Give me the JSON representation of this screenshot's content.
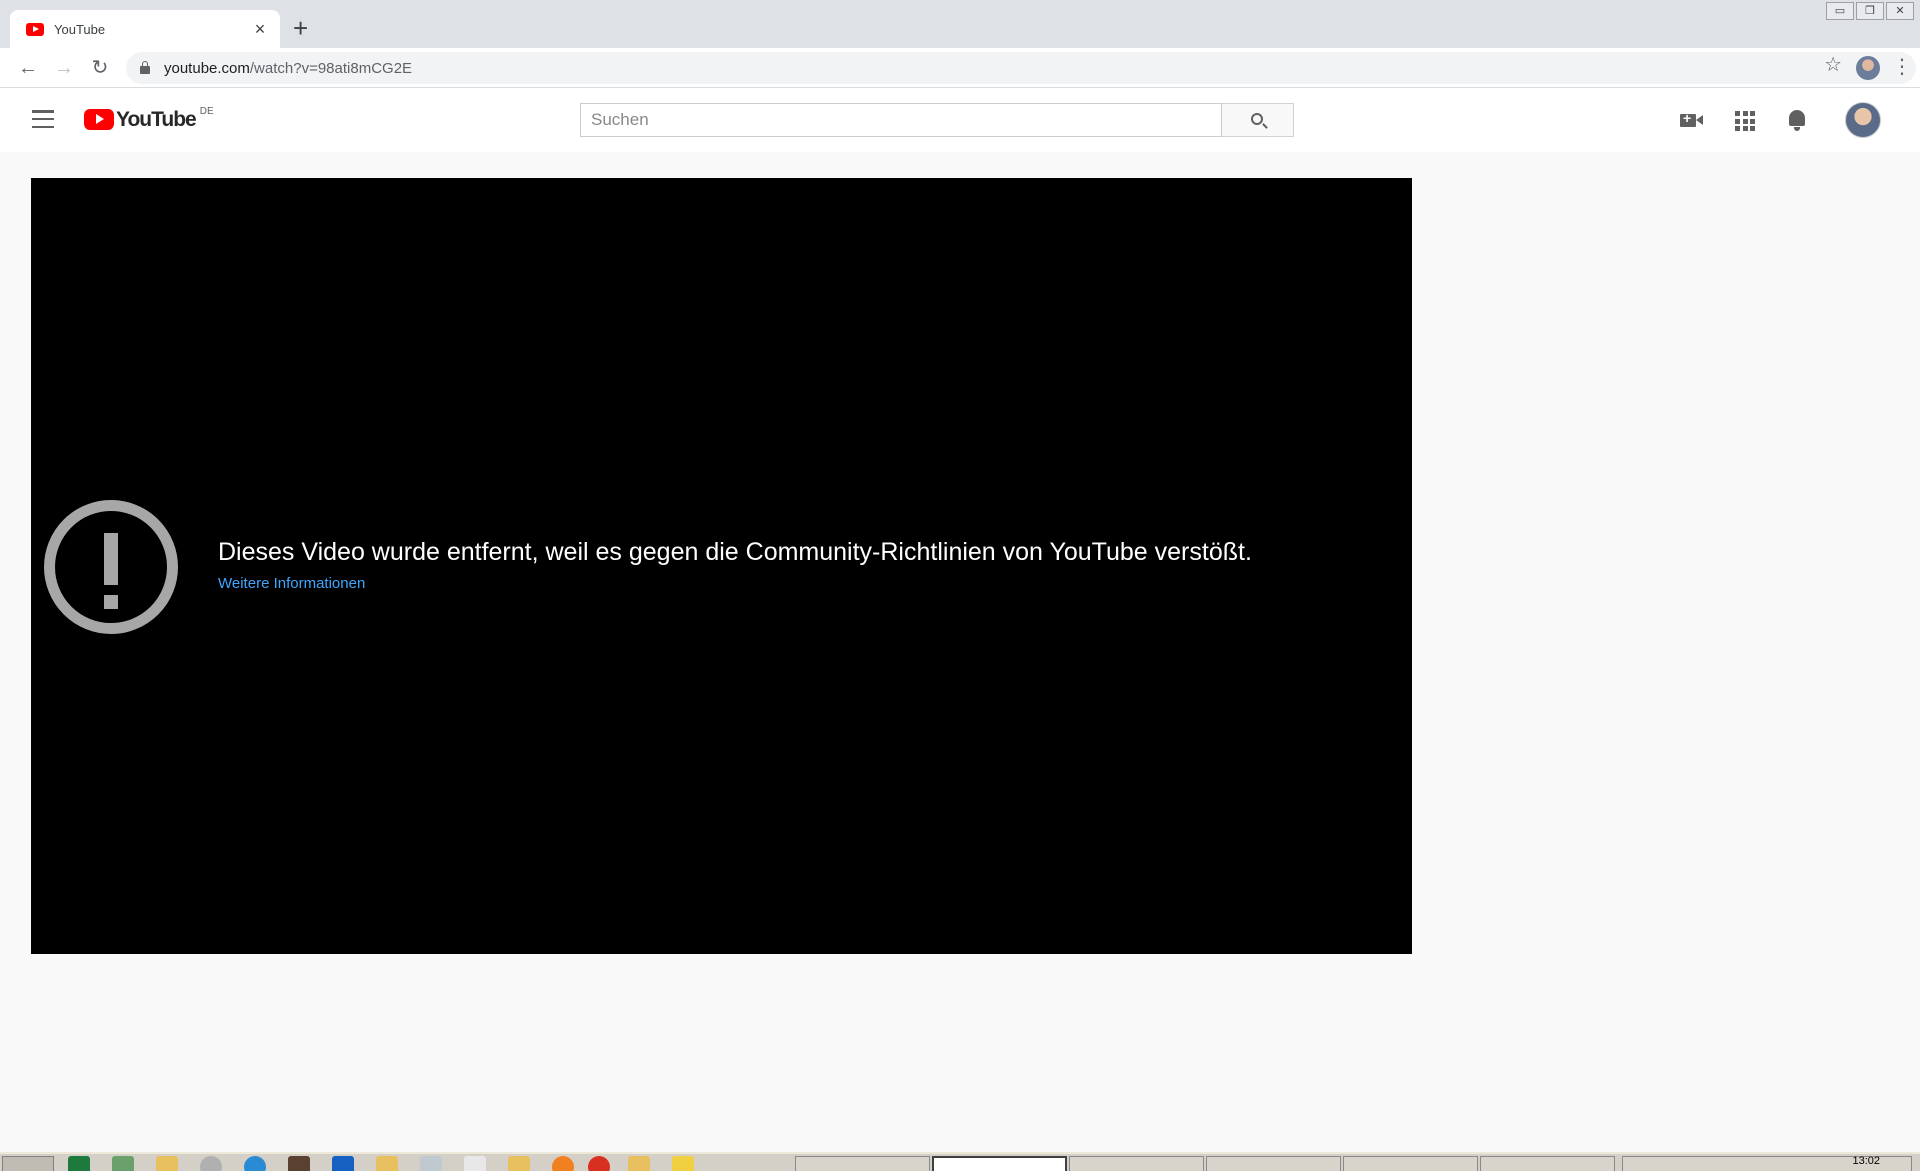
{
  "browser": {
    "tab_title": "YouTube",
    "tab_close": "×",
    "new_tab": "+",
    "url_domain": "youtube.com",
    "url_path": "/watch?v=98ati8mCG2E",
    "window_controls": [
      "▭",
      "❐",
      "✕"
    ]
  },
  "masthead": {
    "logo_text": "YouTube",
    "country_code": "DE",
    "search_placeholder": "Suchen"
  },
  "player": {
    "error_message": "Dieses Video wurde entfernt, weil es gegen die Community-Richtlinien von YouTube verstößt.",
    "learn_more": "Weitere Informationen"
  },
  "taskbar": {
    "clock": "13:02"
  },
  "colors": {
    "youtube_red": "#ff0000",
    "link_blue": "#3ea6ff",
    "error_icon_gray": "#a7a7a7"
  }
}
